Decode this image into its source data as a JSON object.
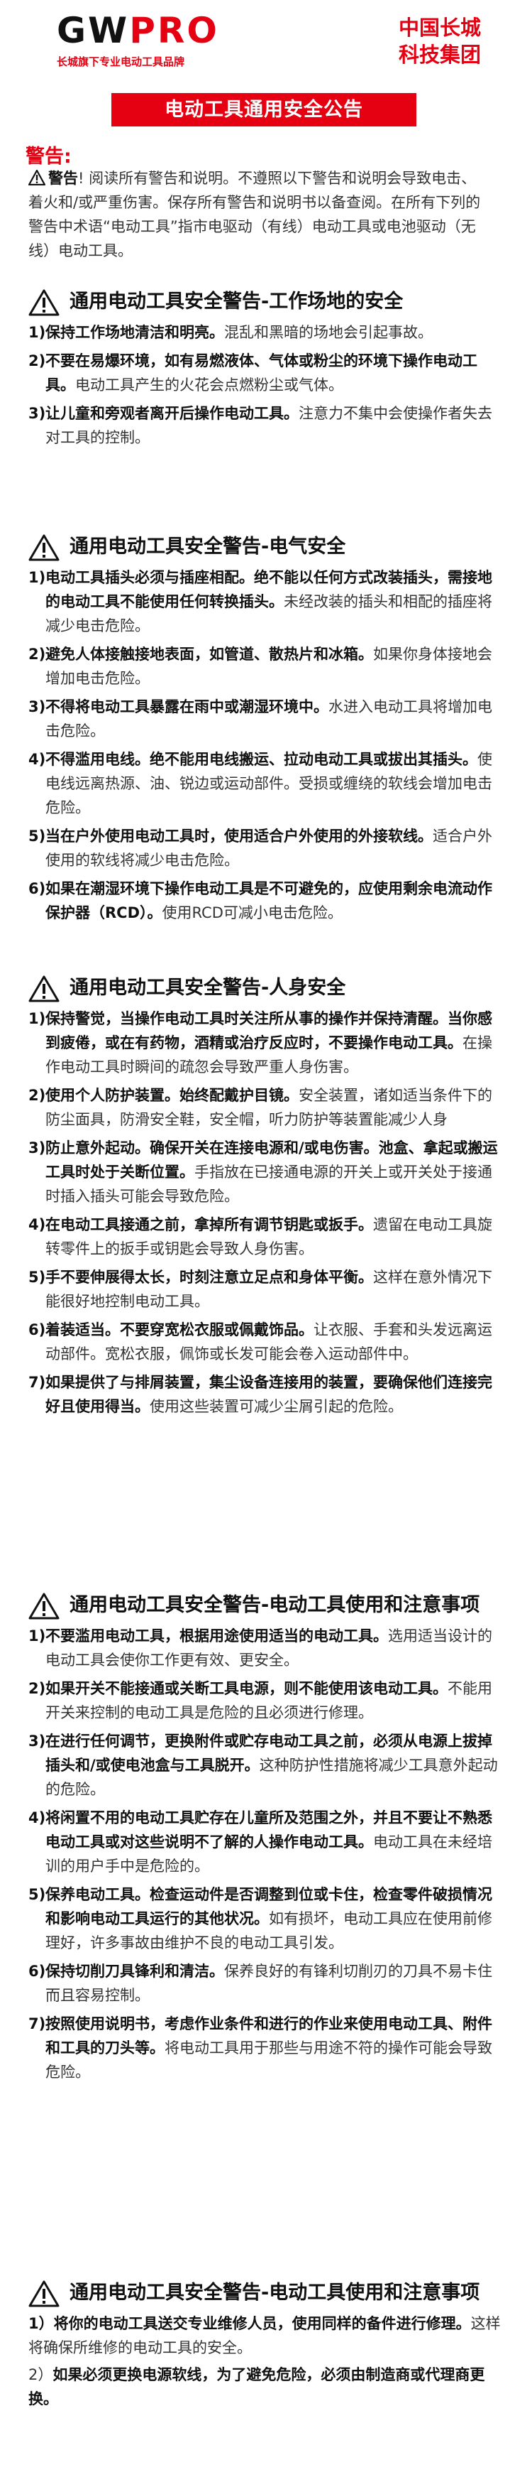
{
  "header": {
    "logo_text": "GW",
    "logo_text2": "PRO",
    "tagline": "长城旗下专业电动工具品牌",
    "company_line1": "中国长城",
    "company_line2": "科技集团"
  },
  "banner": "电动工具通用安全公告",
  "warning_head": "警告:",
  "intro": {
    "bold": "警告",
    "text": "! 阅读所有警告和说明。不遵照以下警告和说明会导致电击、着火和/或严重伤害。保存所有警告和说明书以备查阅。在所有下列的警告中术语“电动工具”指市电驱动（有线）电动工具或电池驱动（无线）电动工具。"
  },
  "sections": [
    {
      "title": "通用电动工具安全警告-工作场地的安全",
      "items": [
        {
          "n": "1)",
          "b": "保持工作场地清洁和明亮。",
          "t": "混乱和黑暗的场地会引起事故。"
        },
        {
          "n": "2)",
          "b": "不要在易爆环境，如有易燃液体、气体或粉尘的环境下操作电动工具。",
          "t": "电动工具产生的火花会点燃粉尘或气体。"
        },
        {
          "n": "3)",
          "b": "让儿童和旁观者离开后操作电动工具。",
          "t": "注意力不集中会使操作者失去对工具的控制。"
        }
      ]
    },
    {
      "title": "通用电动工具安全警告-电气安全",
      "items": [
        {
          "n": "1)",
          "b": "电动工具插头必须与插座相配。绝不能以任何方式改装插头，需接地的电动工具不能使用任何转换插头。",
          "t": "未经改装的插头和相配的插座将减少电击危险。"
        },
        {
          "n": "2)",
          "b": "避免人体接触接地表面，如管道、散热片和冰箱。",
          "t": "如果你身体接地会增加电击危险。"
        },
        {
          "n": "3)",
          "b": "不得将电动工具暴露在雨中或潮湿环境中。",
          "t": "水进入电动工具将增加电击危险。"
        },
        {
          "n": "4)",
          "b": "不得滥用电线。绝不能用电线搬运、拉动电动工具或拔出其插头。",
          "t": "使电线远离热源、油、锐边或运动部件。受损或缠绕的软线会增加电击危险。"
        },
        {
          "n": "5)",
          "b": "当在户外使用电动工具时，使用适合户外使用的外接软线。",
          "t": "适合户外使用的软线将减少电击危险。"
        },
        {
          "n": "6)",
          "b": "如果在潮湿环境下操作电动工具是不可避免的，应使用剩余电流动作保护器（RCD）。",
          "t": "使用RCD可减小电击危险。"
        }
      ]
    },
    {
      "title": "通用电动工具安全警告-人身安全",
      "items": [
        {
          "n": "1)",
          "b": "保持警觉，当操作电动工具时关注所从事的操作并保持清醒。当你感到疲倦，或在有药物，酒精或治疗反应时，不要操作电动工具。",
          "t": "在操作电动工具时瞬间的疏忽会导致严重人身伤害。"
        },
        {
          "n": "2)",
          "b": "使用个人防护装置。始终配戴护目镜。",
          "t": "安全装置，诸如适当条件下的防尘面具，防滑安全鞋，安全帽，听力防护等装置能减少人身"
        },
        {
          "n": "3)",
          "b": "防止意外起动。确保开关在连接电源和/或电伤害。池盒、拿起或搬运工具时处于关断位置。",
          "t": "手指放在已接通电源的开关上或开关处于接通时插入插头可能会导致危险。"
        },
        {
          "n": "4)",
          "b": "在电动工具接通之前，拿掉所有调节钥匙或扳手。",
          "t": "遗留在电动工具旋转零件上的扳手或钥匙会导致人身伤害。"
        },
        {
          "n": "5)",
          "b": "手不要伸展得太长，时刻注意立足点和身体平衡。",
          "t": "这样在意外情况下能很好地控制电动工具。"
        },
        {
          "n": "6)",
          "b": "着装适当。不要穿宽松衣服或佩戴饰品。",
          "t": "让衣服、手套和头发远离运动部件。宽松衣服，佩饰或长发可能会卷入运动部件中。"
        },
        {
          "n": "7)",
          "b": "如果提供了与排屑装置，集尘设备连接用的装置，要确保他们连接完好且使用得当。",
          "t": "使用这些装置可减少尘屑引起的危险。"
        }
      ]
    },
    {
      "title": "通用电动工具安全警告-电动工具使用和注意事项",
      "items": [
        {
          "n": "1)",
          "b": "不要滥用电动工具，根据用途使用适当的电动工具。",
          "t": "选用适当设计的电动工具会使你工作更有效、更安全。"
        },
        {
          "n": "2)",
          "b": "如果开关不能接通或关断工具电源，则不能使用该电动工具。",
          "t": "不能用开关来控制的电动工具是危险的且必须进行修理。"
        },
        {
          "n": "3)",
          "b": "在进行任何调节，更换附件或贮存电动工具之前，必须从电源上拔掉插头和/或使电池盒与工具脱开。",
          "t": "这种防护性措施将减少工具意外起动的危险。"
        },
        {
          "n": "4)",
          "b": "将闲置不用的电动工具贮存在儿童所及范围之外，并且不要让不熟悉电动工具或对这些说明不了解的人操作电动工具。",
          "t": "电动工具在未经培训的用户手中是危险的。"
        },
        {
          "n": "5)",
          "b": "保养电动工具。检查运动件是否调整到位或卡住，检查零件破损情况和影响电动工具运行的其他状况。",
          "t": "如有损坏，电动工具应在使用前修理好，许多事故由维护不良的电动工具引发。"
        },
        {
          "n": "6)",
          "b": "保持切削刀具锋利和清洁。",
          "t": "保养良好的有锋利切削刃的刀具不易卡住而且容易控制。"
        },
        {
          "n": "7)",
          "b": "按照使用说明书，考虑作业条件和进行的作业来使用电动工具、附件和工具的刀头等。",
          "t": "将电动工具用于那些与用途不符的操作可能会导致危险。"
        }
      ]
    },
    {
      "title": "通用电动工具安全警告-电动工具使用和注意事项",
      "p1_n": "1）",
      "p1_b": "将你的电动工具送交专业维修人员，使用同样的备件进行修理。",
      "p1_t": "这样将确保所维修的电动工具的安全。",
      "p2_n": "2）",
      "p2_b": "如果必须更换电源软线，为了避免危险，必须由制造商或代理商更换。"
    }
  ],
  "colors": {
    "accent": "#e50012",
    "text": "#333333",
    "heading": "#111111"
  }
}
